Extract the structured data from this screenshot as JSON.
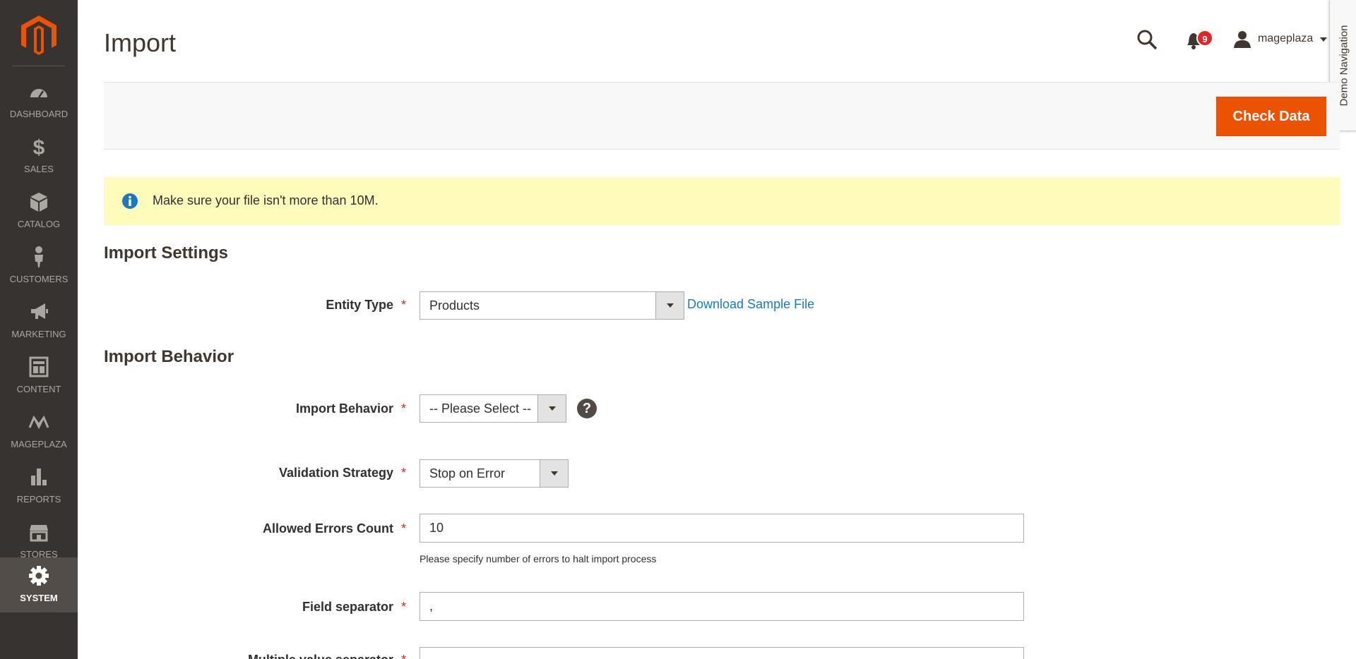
{
  "sidebar": {
    "logo": "magento-logo-icon",
    "items": [
      {
        "label": "DASHBOARD",
        "icon": "dashboard-icon"
      },
      {
        "label": "SALES",
        "icon": "dollar-icon"
      },
      {
        "label": "CATALOG",
        "icon": "box-icon"
      },
      {
        "label": "CUSTOMERS",
        "icon": "person-icon"
      },
      {
        "label": "MARKETING",
        "icon": "megaphone-icon"
      },
      {
        "label": "CONTENT",
        "icon": "layout-icon"
      },
      {
        "label": "MAGEPLAZA",
        "icon": "mageplaza-icon"
      },
      {
        "label": "REPORTS",
        "icon": "bar-chart-icon"
      },
      {
        "label": "STORES",
        "icon": "store-icon"
      },
      {
        "label": "SYSTEM",
        "icon": "gear-icon",
        "active": true
      }
    ]
  },
  "header": {
    "title": "Import",
    "notifications_count": "9",
    "username": "mageplaza",
    "demo_navigation": "Demo Navigation"
  },
  "actions": {
    "check_data_label": "Check Data"
  },
  "notice": {
    "text": "Make sure your file isn't more than 10M."
  },
  "import_settings": {
    "title": "Import Settings",
    "entity_type_label": "Entity Type",
    "entity_type_value": "Products",
    "download_sample_label": "Download Sample File"
  },
  "import_behavior": {
    "title": "Import Behavior",
    "behavior_label": "Import Behavior",
    "behavior_value": "-- Please Select --",
    "help": "?",
    "validation_label": "Validation Strategy",
    "validation_value": "Stop on Error",
    "allowed_errors_label": "Allowed Errors Count",
    "allowed_errors_value": "10",
    "allowed_errors_note": "Please specify number of errors to halt import process",
    "field_separator_label": "Field separator",
    "field_separator_value": ",",
    "multiple_separator_label": "Multiple value separator"
  },
  "colors": {
    "sidebar_bg": "#373330",
    "accent": "#eb5202",
    "link": "#1979c3",
    "required": "#e22626",
    "notice_bg": "#fffbbb"
  }
}
